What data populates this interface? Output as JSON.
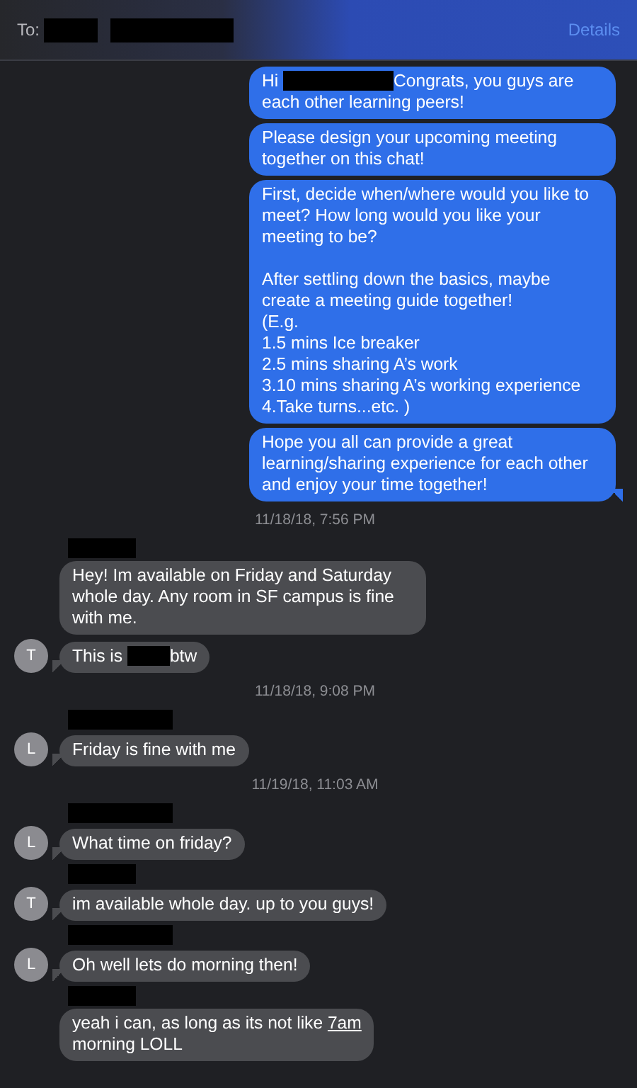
{
  "header": {
    "to_label": "To:",
    "details": "Details"
  },
  "messages": [
    {
      "kind": "message",
      "outgoing": true,
      "tail": false,
      "parts": [
        {
          "kind": "text",
          "text": "Hi "
        },
        {
          "kind": "redaction"
        },
        {
          "kind": "text",
          "text": "Congrats, you guys are each other learning peers!"
        }
      ]
    },
    {
      "kind": "message",
      "outgoing": true,
      "tail": false,
      "parts": [
        {
          "kind": "text",
          "text": "Please design your upcoming meeting together on this chat!"
        }
      ]
    },
    {
      "kind": "message",
      "outgoing": true,
      "tail": false,
      "parts": [
        {
          "kind": "text",
          "text": "First, decide when/where would you like to meet? How long would you like your meeting to be?\n\nAfter settling down the basics, maybe create a meeting guide together!\n(E.g.\n1.5 mins Ice breaker\n2.5 mins sharing A’s work\n3.10 mins sharing A’s working experience\n4.Take turns...etc. )"
        }
      ]
    },
    {
      "kind": "message",
      "outgoing": true,
      "tail": true,
      "parts": [
        {
          "kind": "text",
          "text": "Hope you all can provide a great learning/sharing experience for each other and enjoy your time together!"
        }
      ]
    },
    {
      "kind": "timestamp",
      "text": "11/18/18, 7:56 PM"
    },
    {
      "kind": "message",
      "outgoing": false,
      "sender_redacted": true,
      "tail": false,
      "parts": [
        {
          "kind": "text",
          "text": "Hey! Im available on Friday and Saturday whole day. Any room in SF campus is fine with me."
        }
      ]
    },
    {
      "kind": "message",
      "outgoing": false,
      "avatar": "T",
      "tail": true,
      "parts": [
        {
          "kind": "text",
          "text": "This is "
        },
        {
          "kind": "redaction"
        },
        {
          "kind": "text",
          "text": "btw"
        }
      ]
    },
    {
      "kind": "timestamp",
      "text": "11/18/18, 9:08 PM"
    },
    {
      "kind": "message",
      "outgoing": false,
      "sender_redacted": true,
      "avatar": "L",
      "tail": true,
      "parts": [
        {
          "kind": "text",
          "text": "Friday is fine with me"
        }
      ]
    },
    {
      "kind": "timestamp",
      "text": "11/19/18, 11:03 AM"
    },
    {
      "kind": "message",
      "outgoing": false,
      "sender_redacted": true,
      "avatar": "L",
      "tail": true,
      "parts": [
        {
          "kind": "text",
          "text": "What time on friday?"
        }
      ]
    },
    {
      "kind": "message",
      "outgoing": false,
      "sender_redacted": true,
      "avatar": "T",
      "tail": true,
      "parts": [
        {
          "kind": "text",
          "text": "im available whole day. up to you guys!"
        }
      ]
    },
    {
      "kind": "message",
      "outgoing": false,
      "sender_redacted": true,
      "avatar": "L",
      "tail": true,
      "parts": [
        {
          "kind": "text",
          "text": "Oh well lets do morning then!"
        }
      ]
    },
    {
      "kind": "message",
      "outgoing": false,
      "sender_redacted": true,
      "tail": false,
      "parts": [
        {
          "kind": "text",
          "text": "yeah i can, as long as its not like "
        },
        {
          "kind": "link",
          "text": "7am"
        },
        {
          "kind": "text",
          "text": "\nmorning LOLL"
        }
      ]
    }
  ]
}
